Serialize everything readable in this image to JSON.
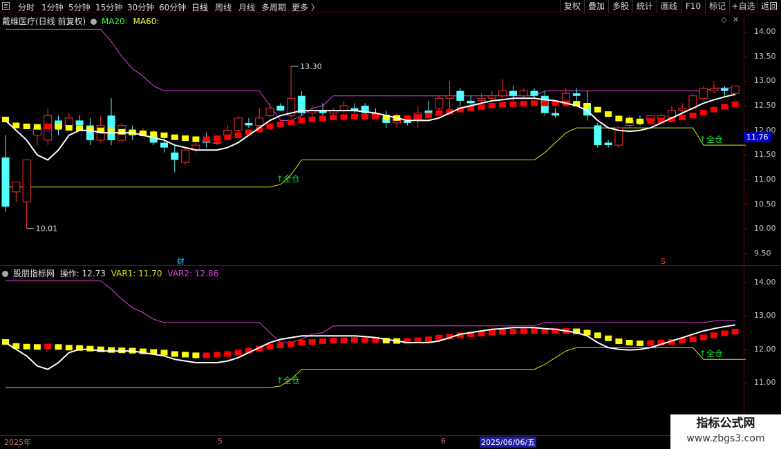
{
  "toolbar": {
    "timeframes": [
      "分时",
      "1分钟",
      "5分钟",
      "15分钟",
      "30分钟",
      "60分钟",
      "日线",
      "周线",
      "月线",
      "多周期",
      "更多 〉"
    ],
    "active_timeframe": "日线",
    "buttons": [
      "复权",
      "叠加",
      "多股",
      "统计",
      "画线",
      "F10",
      "标记",
      "+自选",
      "返回"
    ]
  },
  "main_panel": {
    "title": "戴维医疗(日线 前复权)",
    "ma20_label": "MA20:",
    "ma60_label": "MA60:",
    "high_label": "13.30",
    "low_label": "10.01",
    "signal_1": "↑全仓",
    "signal_2": "↑全仓",
    "marker_cai": "财",
    "marker_s": "S",
    "current_price": "11.76",
    "y_ticks": [
      "14.00",
      "13.50",
      "13.00",
      "12.50",
      "12.00",
      "11.50",
      "11.00",
      "10.50",
      "10.00",
      "9.50"
    ]
  },
  "indicator_panel": {
    "title": "股朋指标网",
    "op_label": "操作: 12.73",
    "var1_label": "VAR1: 11.70",
    "var2_label": "VAR2: 12.86",
    "signal_1": "↑全仓",
    "signal_2": "↑全仓",
    "y_ticks": [
      "14.00",
      "13.00",
      "12.00",
      "11.00"
    ]
  },
  "date_axis": {
    "labels": [
      "2025年",
      "5",
      "6"
    ],
    "selected_date": "2025/06/06/五"
  },
  "watermark": {
    "title": "指标公式网",
    "url": "www.zbgs3.com"
  },
  "colors": {
    "up": "#ff3030",
    "down": "#54ffff",
    "var1": "#e6e600",
    "var2": "#e040e0",
    "op_line": "#ffffff",
    "ma_up": "#ff0000",
    "ma_down": "#ffff00",
    "signal": "#00e040"
  },
  "chart_data": {
    "type": "candlestick",
    "price_range": [
      9.3,
      14.2
    ],
    "candles": [
      {
        "o": 11.45,
        "h": 11.9,
        "l": 10.35,
        "c": 10.45
      },
      {
        "o": 10.75,
        "h": 10.95,
        "l": 10.55,
        "c": 10.95
      },
      {
        "o": 10.55,
        "h": 11.4,
        "l": 10.01,
        "c": 11.4
      },
      {
        "o": 11.9,
        "h": 12.1,
        "l": 11.7,
        "c": 12.05
      },
      {
        "o": 11.8,
        "h": 12.45,
        "l": 11.7,
        "c": 12.3
      },
      {
        "o": 12.2,
        "h": 12.3,
        "l": 11.9,
        "c": 12.05
      },
      {
        "o": 12.1,
        "h": 12.35,
        "l": 12.0,
        "c": 12.25
      },
      {
        "o": 12.2,
        "h": 12.3,
        "l": 12.05,
        "c": 12.1
      },
      {
        "o": 12.1,
        "h": 12.25,
        "l": 11.7,
        "c": 11.8
      },
      {
        "o": 11.8,
        "h": 12.3,
        "l": 11.75,
        "c": 12.1
      },
      {
        "o": 12.3,
        "h": 12.65,
        "l": 11.7,
        "c": 11.8
      },
      {
        "o": 11.8,
        "h": 12.15,
        "l": 11.75,
        "c": 12.1
      },
      {
        "o": 12.0,
        "h": 12.1,
        "l": 11.8,
        "c": 11.9
      },
      {
        "o": 11.95,
        "h": 12.05,
        "l": 11.85,
        "c": 11.95
      },
      {
        "o": 11.9,
        "h": 12.0,
        "l": 11.7,
        "c": 11.75
      },
      {
        "o": 11.75,
        "h": 11.85,
        "l": 11.55,
        "c": 11.65
      },
      {
        "o": 11.55,
        "h": 11.7,
        "l": 11.15,
        "c": 11.4
      },
      {
        "o": 11.35,
        "h": 11.65,
        "l": 11.3,
        "c": 11.6
      },
      {
        "o": 11.6,
        "h": 11.75,
        "l": 11.55,
        "c": 11.7
      },
      {
        "o": 11.8,
        "h": 11.95,
        "l": 11.65,
        "c": 11.75
      },
      {
        "o": 11.75,
        "h": 11.8,
        "l": 11.7,
        "c": 11.75
      },
      {
        "o": 11.9,
        "h": 12.1,
        "l": 11.8,
        "c": 12.0
      },
      {
        "o": 12.0,
        "h": 12.3,
        "l": 11.95,
        "c": 12.25
      },
      {
        "o": 12.15,
        "h": 12.25,
        "l": 12.05,
        "c": 12.1
      },
      {
        "o": 12.1,
        "h": 12.45,
        "l": 12.05,
        "c": 12.25
      },
      {
        "o": 12.3,
        "h": 12.55,
        "l": 12.25,
        "c": 12.45
      },
      {
        "o": 12.5,
        "h": 12.55,
        "l": 12.4,
        "c": 12.4
      },
      {
        "o": 12.3,
        "h": 13.3,
        "l": 12.25,
        "c": 12.65
      },
      {
        "o": 12.7,
        "h": 12.8,
        "l": 12.3,
        "c": 12.35
      },
      {
        "o": 12.35,
        "h": 12.5,
        "l": 12.2,
        "c": 12.4
      },
      {
        "o": 12.4,
        "h": 12.55,
        "l": 12.3,
        "c": 12.35
      },
      {
        "o": 12.35,
        "h": 12.45,
        "l": 12.3,
        "c": 12.4
      },
      {
        "o": 12.4,
        "h": 12.6,
        "l": 12.35,
        "c": 12.5
      },
      {
        "o": 12.45,
        "h": 12.55,
        "l": 12.35,
        "c": 12.4
      },
      {
        "o": 12.5,
        "h": 12.55,
        "l": 12.3,
        "c": 12.35
      },
      {
        "o": 12.35,
        "h": 12.45,
        "l": 12.25,
        "c": 12.3
      },
      {
        "o": 12.25,
        "h": 12.4,
        "l": 12.05,
        "c": 12.15
      },
      {
        "o": 12.15,
        "h": 12.35,
        "l": 12.05,
        "c": 12.25
      },
      {
        "o": 12.2,
        "h": 12.3,
        "l": 12.1,
        "c": 12.15
      },
      {
        "o": 12.2,
        "h": 12.5,
        "l": 12.05,
        "c": 12.35
      },
      {
        "o": 12.4,
        "h": 12.6,
        "l": 12.3,
        "c": 12.35
      },
      {
        "o": 12.45,
        "h": 12.7,
        "l": 12.4,
        "c": 12.65
      },
      {
        "o": 12.65,
        "h": 13.0,
        "l": 12.4,
        "c": 12.7
      },
      {
        "o": 12.8,
        "h": 12.85,
        "l": 12.5,
        "c": 12.6
      },
      {
        "o": 12.6,
        "h": 12.7,
        "l": 12.5,
        "c": 12.55
      },
      {
        "o": 12.6,
        "h": 12.75,
        "l": 12.55,
        "c": 12.65
      },
      {
        "o": 12.65,
        "h": 12.8,
        "l": 12.55,
        "c": 12.7
      },
      {
        "o": 12.7,
        "h": 13.05,
        "l": 12.65,
        "c": 12.8
      },
      {
        "o": 12.8,
        "h": 12.9,
        "l": 12.6,
        "c": 12.7
      },
      {
        "o": 12.7,
        "h": 12.85,
        "l": 12.65,
        "c": 12.8
      },
      {
        "o": 12.8,
        "h": 12.85,
        "l": 12.65,
        "c": 12.7
      },
      {
        "o": 12.7,
        "h": 12.8,
        "l": 12.3,
        "c": 12.35
      },
      {
        "o": 12.35,
        "h": 12.45,
        "l": 12.25,
        "c": 12.3
      },
      {
        "o": 12.55,
        "h": 12.85,
        "l": 12.5,
        "c": 12.75
      },
      {
        "o": 12.75,
        "h": 12.85,
        "l": 12.6,
        "c": 12.7
      },
      {
        "o": 12.55,
        "h": 12.8,
        "l": 12.2,
        "c": 12.3
      },
      {
        "o": 12.1,
        "h": 12.15,
        "l": 11.65,
        "c": 11.7
      },
      {
        "o": 11.75,
        "h": 11.8,
        "l": 11.65,
        "c": 11.7
      },
      {
        "o": 11.7,
        "h": 12.1,
        "l": 11.65,
        "c": 12.05
      },
      {
        "o": 12.1,
        "h": 12.3,
        "l": 12.05,
        "c": 12.2
      },
      {
        "o": 12.2,
        "h": 12.3,
        "l": 12.1,
        "c": 12.15
      },
      {
        "o": 12.2,
        "h": 12.3,
        "l": 12.1,
        "c": 12.3
      },
      {
        "o": 12.25,
        "h": 12.35,
        "l": 12.2,
        "c": 12.3
      },
      {
        "o": 12.25,
        "h": 12.5,
        "l": 12.2,
        "c": 12.4
      },
      {
        "o": 12.4,
        "h": 12.55,
        "l": 12.35,
        "c": 12.45
      },
      {
        "o": 12.45,
        "h": 12.75,
        "l": 12.4,
        "c": 12.7
      },
      {
        "o": 12.65,
        "h": 12.9,
        "l": 12.6,
        "c": 12.85
      },
      {
        "o": 12.8,
        "h": 13.0,
        "l": 12.75,
        "c": 12.85
      },
      {
        "o": 12.85,
        "h": 12.9,
        "l": 12.7,
        "c": 12.8
      },
      {
        "o": 12.75,
        "h": 12.9,
        "l": 12.7,
        "c": 12.9
      }
    ],
    "var2": [
      14.05,
      14.05,
      14.05,
      14.05,
      14.05,
      14.05,
      14.05,
      14.05,
      14.05,
      14.05,
      13.8,
      13.5,
      13.25,
      13.1,
      12.9,
      12.8,
      12.8,
      12.8,
      12.8,
      12.8,
      12.8,
      12.8,
      12.8,
      12.8,
      12.8,
      12.5,
      12.2,
      12.2,
      12.3,
      12.45,
      12.5,
      12.7,
      12.7,
      12.7,
      12.7,
      12.7,
      12.7,
      12.7,
      12.7,
      12.7,
      12.7,
      12.7,
      12.7,
      12.7,
      12.7,
      12.7,
      12.7,
      12.7,
      12.7,
      12.7,
      12.7,
      12.8,
      12.8,
      12.8,
      12.8,
      12.8,
      12.8,
      12.8,
      12.8,
      12.8,
      12.8,
      12.8,
      12.8,
      12.8,
      12.8,
      12.8,
      12.8,
      12.85,
      12.86,
      12.86
    ],
    "var1": [
      10.85,
      10.85,
      10.85,
      10.85,
      10.85,
      10.85,
      10.85,
      10.85,
      10.85,
      10.85,
      10.85,
      10.85,
      10.85,
      10.85,
      10.85,
      10.85,
      10.85,
      10.85,
      10.85,
      10.85,
      10.85,
      10.85,
      10.85,
      10.85,
      10.85,
      10.85,
      10.9,
      11.1,
      11.4,
      11.4,
      11.4,
      11.4,
      11.4,
      11.4,
      11.4,
      11.4,
      11.4,
      11.4,
      11.4,
      11.4,
      11.4,
      11.4,
      11.4,
      11.4,
      11.4,
      11.4,
      11.4,
      11.4,
      11.4,
      11.4,
      11.4,
      11.55,
      11.75,
      11.95,
      12.05,
      12.05,
      12.05,
      12.05,
      12.05,
      12.05,
      12.05,
      12.05,
      12.05,
      12.05,
      12.05,
      12.05,
      11.7,
      11.7,
      11.7,
      11.7,
      11.7
    ],
    "op_line": [
      12.2,
      12.0,
      11.8,
      11.5,
      11.4,
      11.6,
      11.9,
      12.0,
      12.0,
      11.95,
      11.95,
      11.95,
      11.95,
      11.9,
      11.85,
      11.8,
      11.7,
      11.65,
      11.6,
      11.6,
      11.6,
      11.65,
      11.75,
      11.9,
      12.05,
      12.2,
      12.3,
      12.35,
      12.4,
      12.4,
      12.4,
      12.4,
      12.4,
      12.4,
      12.38,
      12.35,
      12.3,
      12.25,
      12.2,
      12.2,
      12.2,
      12.25,
      12.35,
      12.45,
      12.5,
      12.55,
      12.6,
      12.62,
      12.65,
      12.65,
      12.65,
      12.62,
      12.6,
      12.55,
      12.5,
      12.4,
      12.2,
      12.05,
      12.0,
      11.98,
      12.0,
      12.05,
      12.15,
      12.25,
      12.35,
      12.45,
      12.55,
      12.62,
      12.68,
      12.73
    ],
    "ma": [
      12.22,
      12.1,
      12.08,
      12.07,
      12.08,
      12.07,
      12.05,
      12.04,
      12.02,
      12.0,
      11.98,
      11.97,
      11.96,
      11.94,
      11.92,
      11.9,
      11.86,
      11.84,
      11.82,
      11.82,
      11.84,
      11.86,
      11.9,
      11.96,
      12.02,
      12.08,
      12.12,
      12.16,
      12.2,
      12.22,
      12.24,
      12.26,
      12.27,
      12.28,
      12.28,
      12.28,
      12.26,
      12.25,
      12.25,
      12.27,
      12.3,
      12.35,
      12.38,
      12.42,
      12.45,
      12.47,
      12.5,
      12.52,
      12.53,
      12.54,
      12.55,
      12.55,
      12.55,
      12.55,
      12.54,
      12.5,
      12.42,
      12.33,
      12.24,
      12.2,
      12.18,
      12.19,
      12.2,
      12.22,
      12.26,
      12.3,
      12.36,
      12.42,
      12.48,
      12.53
    ],
    "signal_points": [
      {
        "index": 26,
        "label": "↑全仓"
      },
      {
        "index": 66,
        "label": "↑全仓"
      }
    ]
  }
}
